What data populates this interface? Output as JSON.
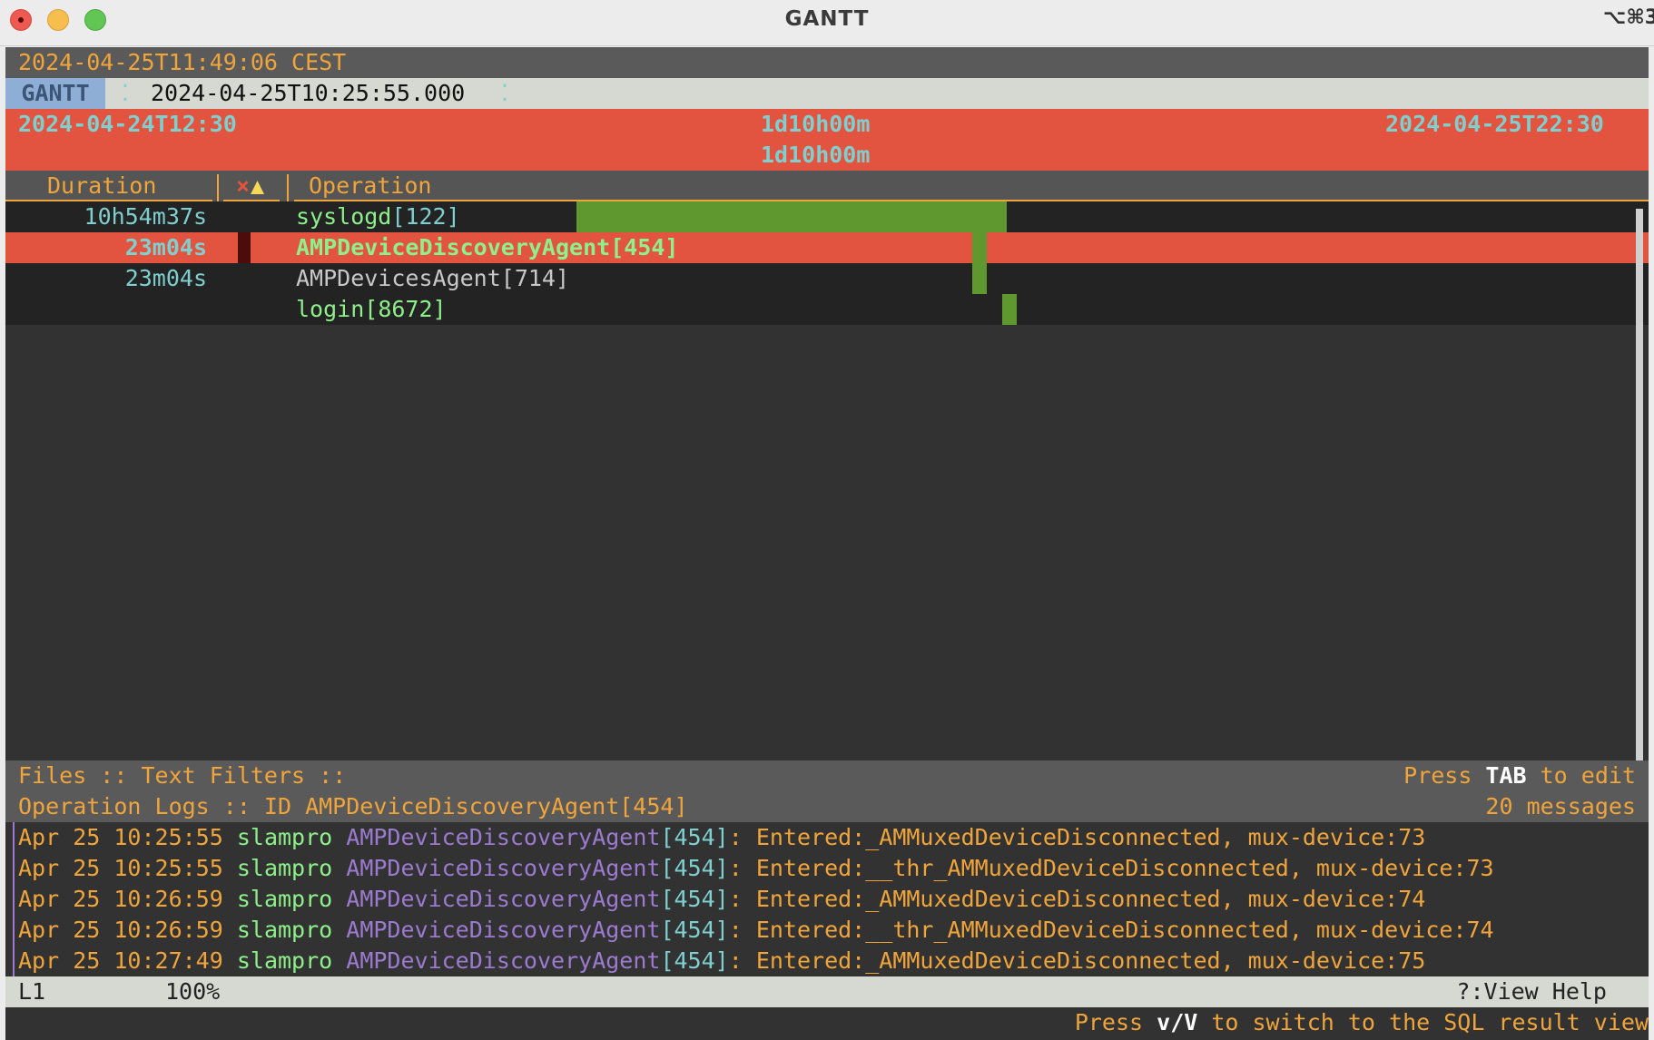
{
  "window": {
    "title": "GANTT",
    "shortcut": "⌥⌘3"
  },
  "clock": "2024-04-25T11:49:06 CEST",
  "breadcrumb": {
    "view": "GANTT",
    "sep": "⁚",
    "position": "2024-04-25T10:25:55.000",
    "sep2": "⁚"
  },
  "time_range": {
    "start": "2024-04-24T12:30",
    "span": "1d10h00m",
    "end": "2024-04-25T22:30",
    "visible_span": "1d10h00m"
  },
  "columns": {
    "duration": "Duration",
    "error_icon": "×",
    "warning_icon": "▲",
    "operation": "Operation"
  },
  "operations": [
    {
      "duration": "10h54m37s",
      "name": "syslogd",
      "pid": "[122]",
      "selected": false,
      "bar_start": 0.3477,
      "bar_end": 0.6094
    },
    {
      "duration": "23m04s",
      "name": "AMPDeviceDiscoveryAgent",
      "pid": "[454]",
      "selected": true,
      "bar_start": 0.5885,
      "bar_end": 0.5971
    },
    {
      "duration": "23m04s",
      "name": "AMPDevicesAgent",
      "pid": "[714]",
      "selected": false,
      "bar_start": 0.5885,
      "bar_end": 0.5971
    },
    {
      "duration": "",
      "name": "login",
      "pid": "[8672]",
      "selected": false,
      "bar_start": 0.6066,
      "bar_end": 0.6152
    }
  ],
  "bottom_panel": {
    "files_label": "Files :: Text Filters ::",
    "tab_hint_pre": "Press ",
    "tab_key": "TAB",
    "tab_hint_post": " to edit",
    "logs_title": "Operation Logs :: ID AMPDeviceDiscoveryAgent[454]",
    "message_count": "20 messages"
  },
  "log_lines": [
    {
      "time": "Apr 25 10:25:55",
      "host": "slampro",
      "proc": "AMPDeviceDiscoveryAgent",
      "pid": "[454]",
      "msg": ": Entered:_AMMuxedDeviceDisconnected, mux-device:73"
    },
    {
      "time": "Apr 25 10:25:55",
      "host": "slampro",
      "proc": "AMPDeviceDiscoveryAgent",
      "pid": "[454]",
      "msg": ": Entered:__thr_AMMuxedDeviceDisconnected, mux-device:73"
    },
    {
      "time": "Apr 25 10:26:59",
      "host": "slampro",
      "proc": "AMPDeviceDiscoveryAgent",
      "pid": "[454]",
      "msg": ": Entered:_AMMuxedDeviceDisconnected, mux-device:74"
    },
    {
      "time": "Apr 25 10:26:59",
      "host": "slampro",
      "proc": "AMPDeviceDiscoveryAgent",
      "pid": "[454]",
      "msg": ": Entered:__thr_AMMuxedDeviceDisconnected, mux-device:74"
    },
    {
      "time": "Apr 25 10:27:49",
      "host": "slampro",
      "proc": "AMPDeviceDiscoveryAgent",
      "pid": "[454]",
      "msg": ": Entered:_AMMuxedDeviceDisconnected, mux-device:75"
    }
  ],
  "status_bar": {
    "line": "L1",
    "percent": "100%",
    "help": "?:View Help"
  },
  "footer_hint": {
    "pre": "Press ",
    "key": "v/V",
    "post": " to switch to the SQL result view"
  },
  "colors": {
    "accent_orange": "#f0a53c",
    "highlight_red": "#e2543f",
    "bar_green": "#5f982e",
    "cyan": "#7fcfcf",
    "purple": "#9b7ad0"
  }
}
